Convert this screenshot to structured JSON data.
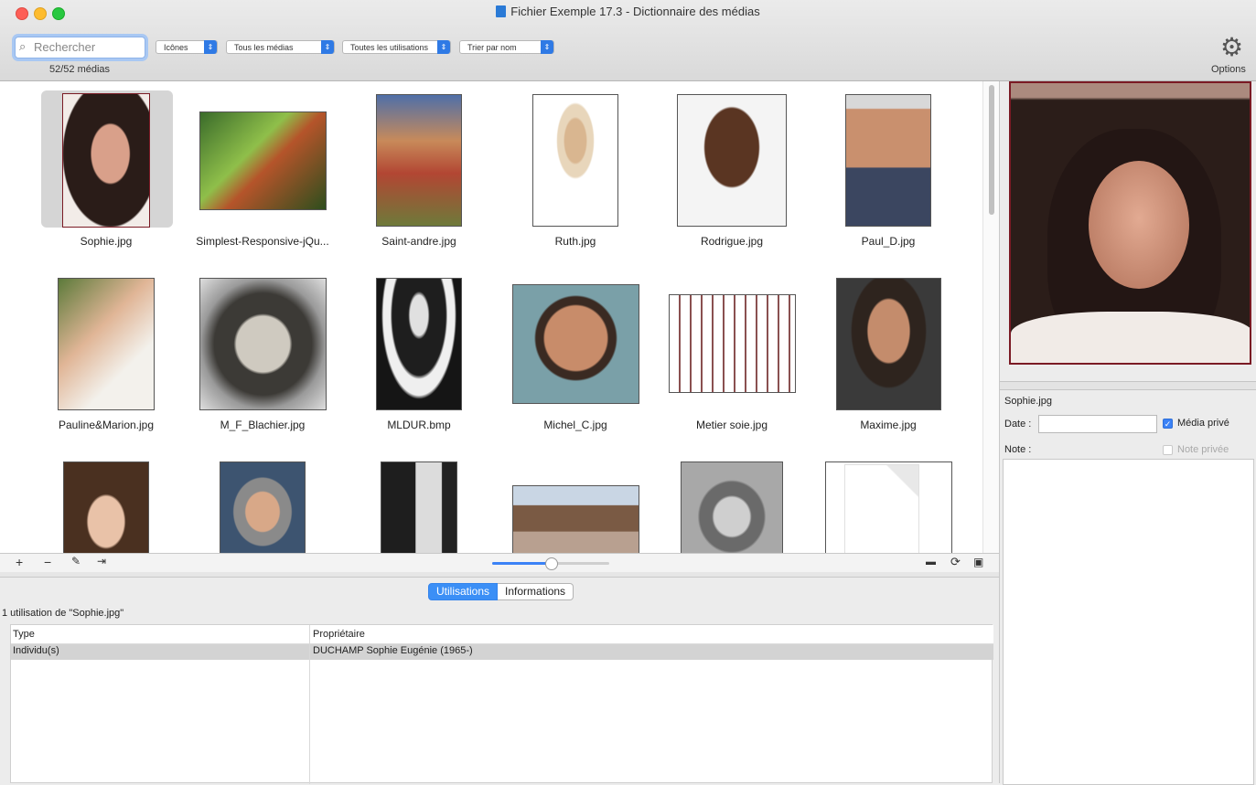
{
  "window": {
    "title": "Fichier Exemple 17.3 - Dictionnaire des médias"
  },
  "toolbar": {
    "search_placeholder": "Rechercher",
    "view_select": "Icônes",
    "media_filter": "Tous les médias",
    "usage_filter": "Toutes les utilisations",
    "sort_select": "Trier par nom",
    "count": "52/52 médias",
    "options_label": "Options"
  },
  "media": [
    {
      "name": "Sophie.jpg"
    },
    {
      "name": "Simplest-Responsive-jQu..."
    },
    {
      "name": "Saint-andre.jpg"
    },
    {
      "name": "Ruth.jpg"
    },
    {
      "name": "Rodrigue.jpg"
    },
    {
      "name": "Paul_D.jpg"
    },
    {
      "name": "Pauline&Marion.jpg"
    },
    {
      "name": "M_F_Blachier.jpg"
    },
    {
      "name": "MLDUR.bmp"
    },
    {
      "name": "Michel_C.jpg"
    },
    {
      "name": "Metier soie.jpg"
    },
    {
      "name": "Maxime.jpg"
    }
  ],
  "bottom_toolbar": {
    "add": "+",
    "remove": "−",
    "edit": "✎",
    "merge": "⇥",
    "zoom_level": 0.5
  },
  "tabs": {
    "usages": "Utilisations",
    "info": "Informations"
  },
  "usage": {
    "title": "1 utilisation de \"Sophie.jpg\"",
    "columns": [
      "Type",
      "Propriétaire"
    ],
    "rows": [
      {
        "type": "Individu(s)",
        "owner": "DUCHAMP Sophie Eugénie (1965-)"
      }
    ]
  },
  "details": {
    "file_name": "Sophie.jpg",
    "date_label": "Date :",
    "date_value": "",
    "private_media_label": "Média privé",
    "private_media_checked": true,
    "note_label": "Note :",
    "private_note_label": "Note privée",
    "private_note_checked": false
  },
  "colors": {
    "accent": "#3b8ff6",
    "selection": "#d5d5d5"
  }
}
